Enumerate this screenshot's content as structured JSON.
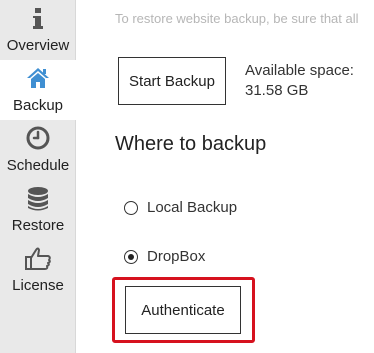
{
  "sidebar": {
    "items": [
      {
        "label": "Overview",
        "icon": "info-icon"
      },
      {
        "label": "Backup",
        "icon": "home-icon",
        "active": true
      },
      {
        "label": "Schedule",
        "icon": "clock-icon"
      },
      {
        "label": "Restore",
        "icon": "database-icon"
      },
      {
        "label": "License",
        "icon": "thumbs-up-icon"
      }
    ],
    "active_icon_color": "#3f8fd2",
    "icon_color": "#555555"
  },
  "main": {
    "notice": "To restore website backup, be sure that all",
    "start_backup_label": "Start Backup",
    "available_space_label": "Available space:",
    "available_space_value": "31.58 GB",
    "section_title": "Where to backup",
    "options": [
      {
        "label": "Local Backup",
        "selected": false
      },
      {
        "label": "DropBox",
        "selected": true
      }
    ],
    "authenticate_label": "Authenticate",
    "highlight_color": "#d6111e"
  }
}
